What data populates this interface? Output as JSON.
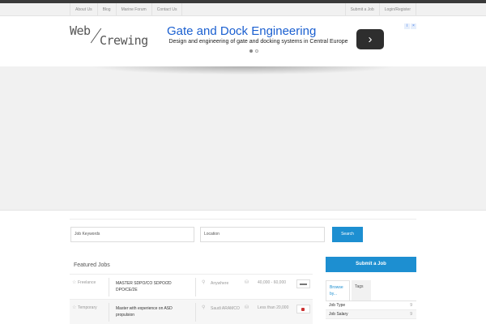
{
  "nav": {
    "left": [
      "About Us",
      "Blog",
      "Marine Forum",
      "Contact Us"
    ],
    "right": [
      "Submit a Job",
      "Login/Register"
    ]
  },
  "logo": {
    "part1": "Web",
    "part2": "Crewing"
  },
  "ad": {
    "title": "Gate and Dock Engineering",
    "description": "Design and engineering of gate and docking systems in Central Europe",
    "button_glyph": "›"
  },
  "search": {
    "keywords_placeholder": "Job Keywords",
    "location_placeholder": "Location",
    "button": "Search"
  },
  "featured": {
    "title": "Featured Jobs",
    "jobs": [
      {
        "type": "Freelance",
        "title": "MASTER SDPO/CO SDPO/2D DPO/CE/2E",
        "location": "Anywhere",
        "salary": "40,000 - 60,000"
      },
      {
        "type": "Temporary",
        "title": "Master with experience on ASD propulsion",
        "location": "Saudi ARAMCO",
        "salary": "Less than 20,000"
      }
    ]
  },
  "sidebar": {
    "submit_button": "Submit a Job",
    "tabs": [
      "Browse by...",
      "Tags"
    ],
    "filters": [
      {
        "label": "Job Type",
        "count": "9"
      },
      {
        "label": "Job Salary",
        "count": "9"
      }
    ]
  },
  "colors": {
    "accent": "#1d8fd1",
    "ad_title": "#1a5fd0",
    "nav_bg": "#f1f1f1"
  }
}
